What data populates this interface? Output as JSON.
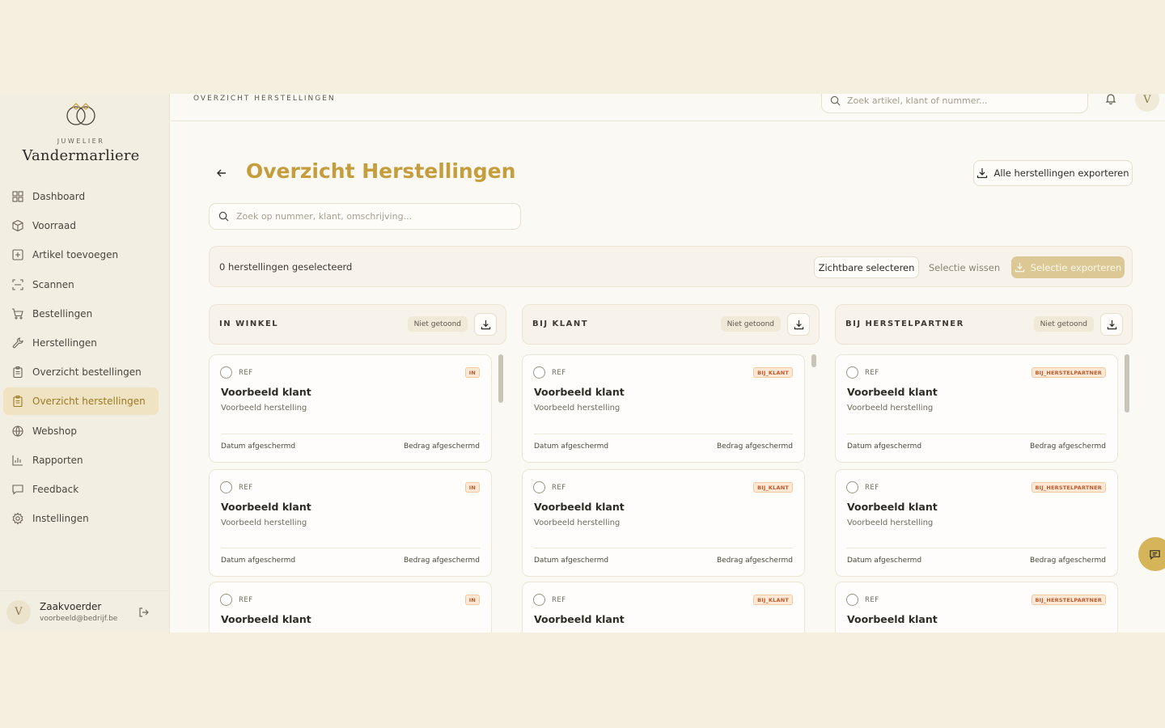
{
  "brand": {
    "small": "JUWELIER",
    "name": "Vandermarliere"
  },
  "nav": [
    {
      "label": "Dashboard",
      "icon": "dashboard-icon"
    },
    {
      "label": "Voorraad",
      "icon": "box-icon"
    },
    {
      "label": "Artikel toevoegen",
      "icon": "plus-square-icon"
    },
    {
      "label": "Scannen",
      "icon": "scan-icon"
    },
    {
      "label": "Bestellingen",
      "icon": "cart-icon"
    },
    {
      "label": "Herstellingen",
      "icon": "wrench-icon"
    },
    {
      "label": "Overzicht bestellingen",
      "icon": "clipboard-icon"
    },
    {
      "label": "Overzicht herstellingen",
      "icon": "clipboard-icon",
      "active": true
    },
    {
      "label": "Webshop",
      "icon": "globe-icon"
    },
    {
      "label": "Rapporten",
      "icon": "bar-chart-icon"
    },
    {
      "label": "Feedback",
      "icon": "message-icon"
    },
    {
      "label": "Instellingen",
      "icon": "settings-icon"
    }
  ],
  "user": {
    "initial": "V",
    "name": "Zaakvoerder",
    "email": "voorbeeld@bedrijf.be"
  },
  "topbar": {
    "breadcrumb": "OVERZICHT HERSTELLINGEN",
    "search_placeholder": "Zoek artikel, klant of nummer...",
    "avatar": "V"
  },
  "page": {
    "title": "Overzicht Herstellingen",
    "export_all": "Alle herstellingen exporteren",
    "search_placeholder": "Zoek op nummer, klant, omschrijving...",
    "selected_count": "0 herstellingen geselecteerd",
    "select_visible": "Zichtbare selecteren",
    "clear_selection": "Selectie wissen",
    "export_selection": "Selectie exporteren"
  },
  "columns": [
    {
      "title": "IN WINKEL",
      "badge": "Niet getoond",
      "tag": "IN",
      "cards": [
        {
          "ref": "REF",
          "client": "Voorbeeld klant",
          "desc": "Voorbeeld herstelling",
          "date": "Datum afgeschermd",
          "amount": "Bedrag afgeschermd"
        },
        {
          "ref": "REF",
          "client": "Voorbeeld klant",
          "desc": "Voorbeeld herstelling",
          "date": "Datum afgeschermd",
          "amount": "Bedrag afgeschermd"
        },
        {
          "ref": "REF",
          "client": "Voorbeeld klant"
        }
      ]
    },
    {
      "title": "BIJ KLANT",
      "badge": "Niet getoond",
      "tag": "BIJ_KLANT",
      "cards": [
        {
          "ref": "REF",
          "client": "Voorbeeld klant",
          "desc": "Voorbeeld herstelling",
          "date": "Datum afgeschermd",
          "amount": "Bedrag afgeschermd"
        },
        {
          "ref": "REF",
          "client": "Voorbeeld klant",
          "desc": "Voorbeeld herstelling",
          "date": "Datum afgeschermd",
          "amount": "Bedrag afgeschermd"
        },
        {
          "ref": "REF",
          "client": "Voorbeeld klant"
        }
      ]
    },
    {
      "title": "BIJ HERSTELPARTNER",
      "badge": "Niet getoond",
      "tag": "BIJ_HERSTELPARTNER",
      "cards": [
        {
          "ref": "REF",
          "client": "Voorbeeld klant",
          "desc": "Voorbeeld herstelling",
          "date": "Datum afgeschermd",
          "amount": "Bedrag afgeschermd"
        },
        {
          "ref": "REF",
          "client": "Voorbeeld klant",
          "desc": "Voorbeeld herstelling",
          "date": "Datum afgeschermd",
          "amount": "Bedrag afgeschermd"
        },
        {
          "ref": "REF",
          "client": "Voorbeeld klant"
        }
      ]
    }
  ],
  "colors": {
    "accent": "#c59d3c",
    "active_bg": "#efe3c3",
    "tag_text": "#c0592b",
    "chat_fab": "#d6b45a"
  }
}
